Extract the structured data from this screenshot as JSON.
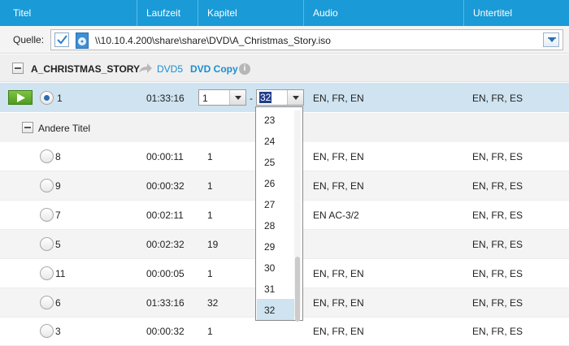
{
  "header": {
    "columns": [
      "Titel",
      "Laufzeit",
      "Kapitel",
      "Audio",
      "Untertitel"
    ]
  },
  "source": {
    "label": "Quelle:",
    "path": "\\\\10.10.4.200\\share\\share\\DVD\\A_Christmas_Story.iso"
  },
  "group": {
    "title": "A_CHRISTMAS_STORY",
    "dvd5": "DVD5",
    "dvd_copy": "DVD Copy",
    "info": "i"
  },
  "selected_title": {
    "number": "1",
    "duration": "01:33:16",
    "chapter_from": "1",
    "dash": "-",
    "chapter_to": "32",
    "audio": "EN, FR, EN",
    "subtitles": "EN, FR, ES"
  },
  "other_titles": {
    "label": "Andere Titel",
    "rows": [
      {
        "number": "8",
        "duration": "00:00:11",
        "chapters": "1",
        "audio": "EN, FR, EN",
        "subtitles": "EN, FR, ES"
      },
      {
        "number": "9",
        "duration": "00:00:32",
        "chapters": "1",
        "audio": "EN, FR, EN",
        "subtitles": "EN, FR, ES"
      },
      {
        "number": "7",
        "duration": "00:02:11",
        "chapters": "1",
        "audio": "EN AC-3/2",
        "subtitles": "EN, FR, ES"
      },
      {
        "number": "5",
        "duration": "00:02:32",
        "chapters": "19",
        "audio": "",
        "subtitles": "EN, FR, ES"
      },
      {
        "number": "11",
        "duration": "00:00:05",
        "chapters": "1",
        "audio": "EN, FR, EN",
        "subtitles": "EN, FR, ES"
      },
      {
        "number": "6",
        "duration": "01:33:16",
        "chapters": "32",
        "audio": "EN, FR, EN",
        "subtitles": "EN, FR, ES"
      },
      {
        "number": "3",
        "duration": "00:00:32",
        "chapters": "1",
        "audio": "EN, FR, EN",
        "subtitles": "EN, FR, ES"
      }
    ]
  },
  "chapter_dropdown": {
    "options": [
      "23",
      "24",
      "25",
      "26",
      "27",
      "28",
      "29",
      "30",
      "31",
      "32"
    ],
    "selected": "32"
  },
  "colors": {
    "header_bg": "#1a9ad6",
    "selected_row_bg": "#cfe3f0",
    "link": "#1a8ed0",
    "play_green": "#5aa82a"
  }
}
